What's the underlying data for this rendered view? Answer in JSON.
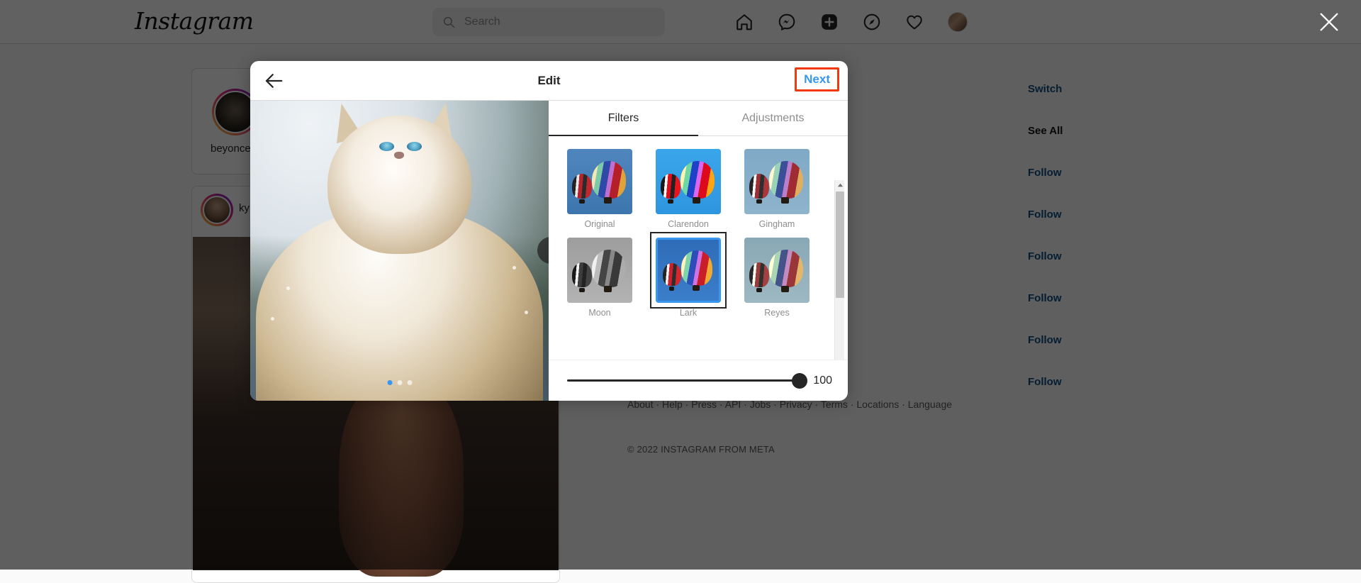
{
  "topbar": {
    "logo": "Instagram",
    "search_placeholder": "Search",
    "search_value": "",
    "icons": [
      "home-icon",
      "messenger-icon",
      "new-post-icon",
      "explore-icon",
      "heart-icon",
      "profile-avatar"
    ]
  },
  "background": {
    "stories": [
      {
        "username": "beyonce"
      },
      {
        "username": "kyliejenner"
      }
    ],
    "sidebar": [
      {
        "label": "Switch",
        "type": "link"
      },
      {
        "label": "See All",
        "type": "strong"
      },
      {
        "label": "Follow",
        "type": "link"
      },
      {
        "label": "Follow",
        "type": "link"
      },
      {
        "label": "Follow",
        "type": "link"
      },
      {
        "label": "Follow",
        "type": "link"
      },
      {
        "label": "Follow",
        "type": "link"
      },
      {
        "label": "Follow",
        "type": "link"
      }
    ],
    "footer_links": "About · Help · Press · API · Jobs · Privacy · Terms · Locations · Language",
    "footer_copy": "© 2022 INSTAGRAM FROM META"
  },
  "close_button": {
    "name": "close-overlay",
    "icon": "close-icon"
  },
  "modal": {
    "title": "Edit",
    "back_label": "back-arrow",
    "next_label": "Next",
    "next_highlight_color": "#f4380d",
    "next_text_color": "#3797f0",
    "preview": {
      "next_arrow_label": "next-image",
      "carousel_total": 3,
      "carousel_active": 1
    },
    "tabs": [
      {
        "label": "Filters",
        "active": true
      },
      {
        "label": "Adjustments",
        "active": false
      }
    ],
    "filters": [
      {
        "label": "Original",
        "selected": false
      },
      {
        "label": "Clarendon",
        "selected": false
      },
      {
        "label": "Gingham",
        "selected": false
      },
      {
        "label": "Moon",
        "selected": false
      },
      {
        "label": "Lark",
        "selected": true
      },
      {
        "label": "Reyes",
        "selected": false
      }
    ],
    "slider": {
      "value": "100",
      "min": "0",
      "max": "100"
    },
    "scrollbar": {
      "up_arrow": "scroll-up-icon",
      "down_arrow": "scroll-down-icon"
    }
  }
}
